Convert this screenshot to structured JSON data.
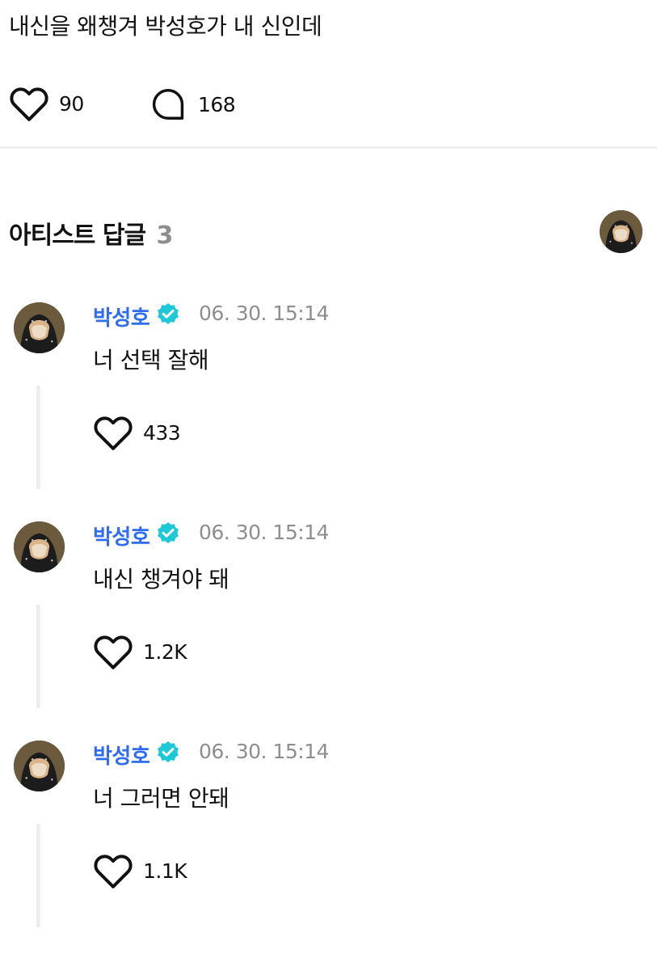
{
  "post": {
    "text": "내신을 왜챙겨 박성호가 내 신인데",
    "likes": "90",
    "comments": "168"
  },
  "artist_replies": {
    "title": "아티스트 답글",
    "count": "3",
    "items": [
      {
        "name": "박성호",
        "time": "06. 30. 15:14",
        "text": "너 선택 잘해",
        "likes": "433"
      },
      {
        "name": "박성호",
        "time": "06. 30. 15:14",
        "text": "내신 챙겨야 돼",
        "likes": "1.2K"
      },
      {
        "name": "박성호",
        "time": "06. 30. 15:14",
        "text": "너 그러면 안돼",
        "likes": "1.1K"
      }
    ]
  },
  "icons": {
    "like": "heart-outline-icon",
    "comment": "speech-bubble-icon",
    "verified": "verified-badge-icon"
  },
  "colors": {
    "artist_name": "#2f6cf0",
    "verified_badge": "#1ec8d6",
    "meta_text": "#8e8e8e",
    "divider": "#eeeeee"
  }
}
